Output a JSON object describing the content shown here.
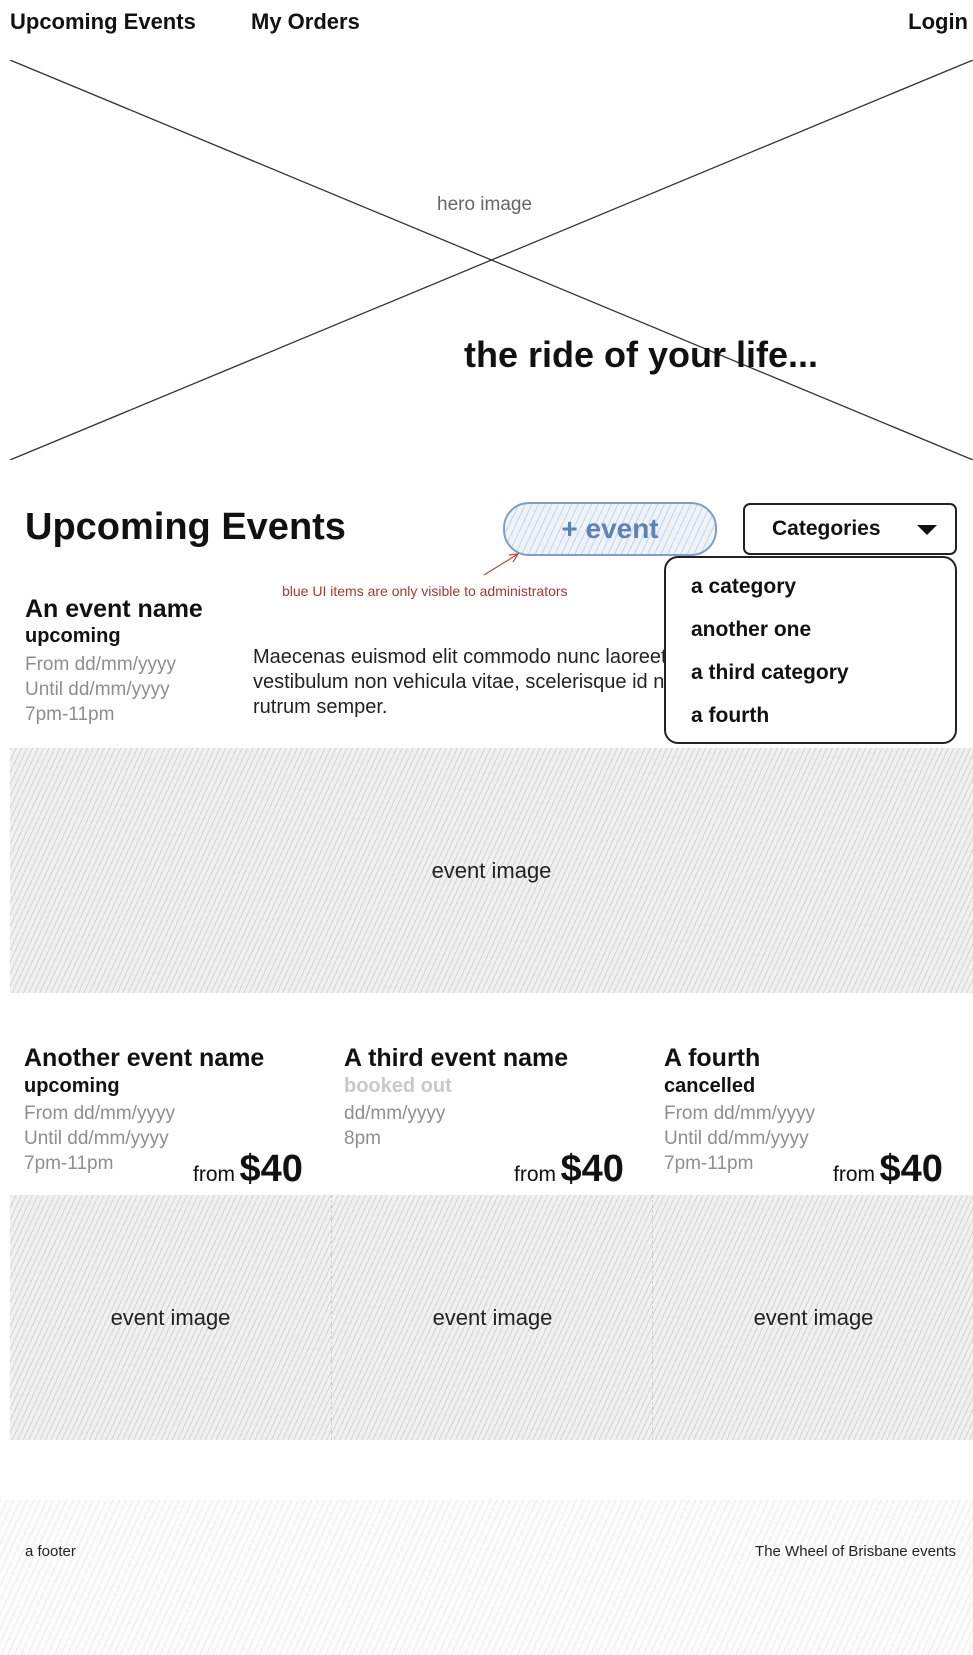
{
  "nav": {
    "upcoming": "Upcoming Events",
    "orders": "My Orders",
    "login": "Login"
  },
  "hero": {
    "image_label": "hero image",
    "tagline": "the ride of your life..."
  },
  "section": {
    "title": "Upcoming Events",
    "add_event_label": "+ event",
    "categories_label": "Categories",
    "admin_note": "blue UI items are only visible to administrators"
  },
  "categories_dropdown": {
    "items": [
      "a category",
      "another one",
      "a third category",
      "a fourth"
    ]
  },
  "featured_event": {
    "name": "An event name",
    "status": "upcoming",
    "from": "From dd/mm/yyyy",
    "until": "Until dd/mm/yyyy",
    "time": "7pm-11pm",
    "description_lines": [
      "Maecenas euismod elit commodo nunc laoreet, vel",
      "vestibulum non vehicula vitae, scelerisque id nisl.",
      "rutrum semper."
    ],
    "image_label": "event image"
  },
  "events": [
    {
      "name": "Another event name",
      "status": "upcoming",
      "lines": [
        "From dd/mm/yyyy",
        "Until dd/mm/yyyy",
        "7pm-11pm"
      ],
      "price_prefix": "from",
      "price": "$40",
      "image_label": "event image"
    },
    {
      "name": "A third event name",
      "status": "booked out",
      "lines": [
        "dd/mm/yyyy",
        "8pm",
        ""
      ],
      "price_prefix": "from",
      "price": "$40",
      "image_label": "event image"
    },
    {
      "name": "A fourth",
      "status": "cancelled",
      "lines": [
        "From dd/mm/yyyy",
        "Until dd/mm/yyyy",
        "7pm-11pm"
      ],
      "price_prefix": "from",
      "price": "$40",
      "image_label": "event image"
    }
  ],
  "footer": {
    "left": "a footer",
    "right": "The Wheel of Brisbane events"
  },
  "colors": {
    "admin_accent": "#5f82b3",
    "admin_note": "#a23b32",
    "muted_text": "#8e8e8e"
  }
}
